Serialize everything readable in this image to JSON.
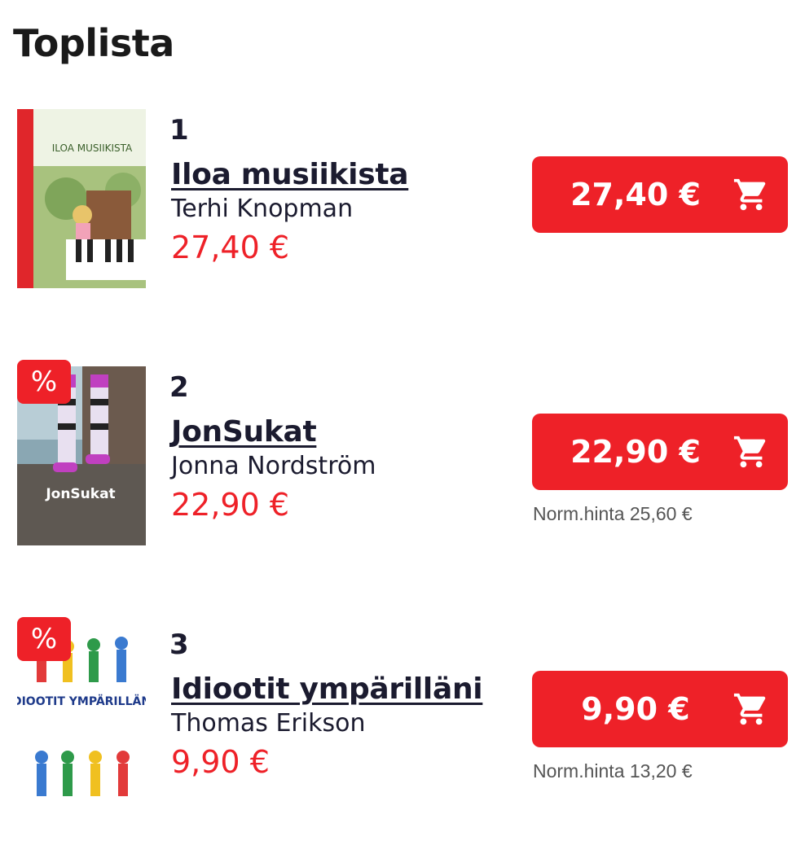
{
  "page": {
    "title": "Toplista"
  },
  "colors": {
    "accent": "#ee2128",
    "text": "#1b1b2f",
    "muted": "#555555"
  },
  "products": [
    {
      "rank": "1",
      "title": "Iloa musiikista",
      "author": "Terhi Knopman",
      "price": "27,40 €",
      "button_price": "27,40 €",
      "discount_badge": "",
      "normal_price": "",
      "cover_text": "ILOA MUSIIKISTA",
      "icon": "shopping-cart-icon"
    },
    {
      "rank": "2",
      "title": "JonSukat",
      "author": "Jonna Nordström",
      "price": "22,90 €",
      "button_price": "22,90 €",
      "discount_badge": "%",
      "normal_price": "Norm.hinta 25,60 €",
      "cover_text": "JonSukat",
      "icon": "shopping-cart-icon"
    },
    {
      "rank": "3",
      "title": "Idiootit ympärilläni",
      "author": "Thomas Erikson",
      "price": "9,90 €",
      "button_price": "9,90 €",
      "discount_badge": "%",
      "normal_price": "Norm.hinta 13,20 €",
      "cover_text": "IDIOOTIT YMPÄRILLÄNI",
      "icon": "shopping-cart-icon"
    }
  ]
}
